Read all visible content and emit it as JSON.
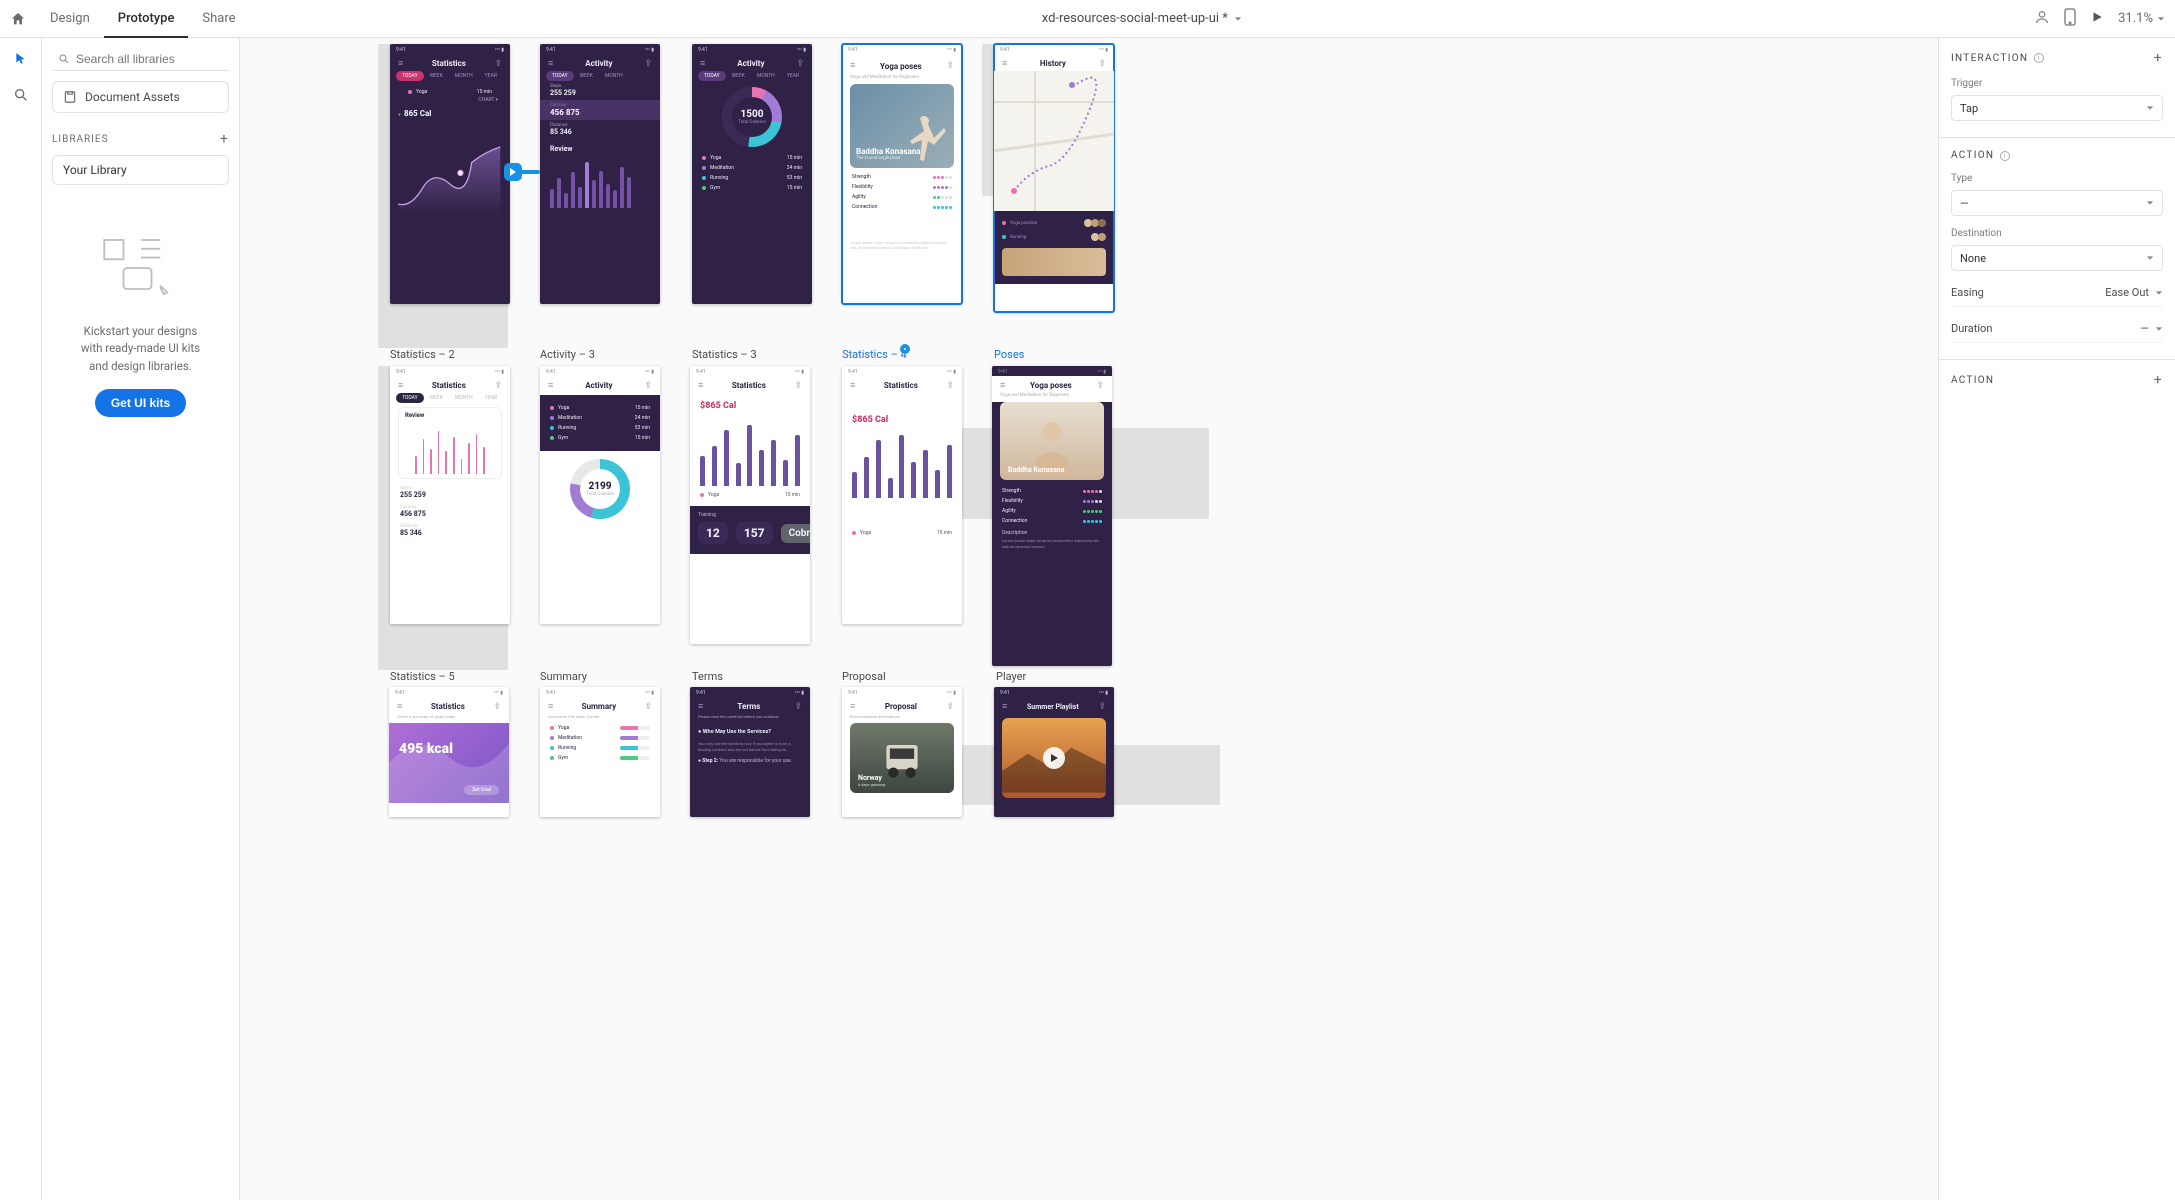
{
  "topbar": {
    "tabs": [
      "Design",
      "Prototype",
      "Share"
    ],
    "active_tab": "Prototype",
    "doc_title": "xd-resources-social-meet-up-ui *",
    "zoom": "31.1%"
  },
  "left_panel": {
    "search_placeholder": "Search all libraries",
    "doc_assets": "Document Assets",
    "libraries_header": "LIBRARIES",
    "your_library": "Your Library",
    "kickstart_lines": [
      "Kickstart your designs",
      "with ready-made UI kits",
      "and design libraries."
    ],
    "cta": "Get UI kits"
  },
  "right_panel": {
    "interaction_header": "INTERACTION",
    "trigger_label": "Trigger",
    "trigger_value": "Tap",
    "action_header": "ACTION",
    "type_label": "Type",
    "type_value": "—",
    "destination_label": "Destination",
    "destination_value": "None",
    "easing_label": "Easing",
    "easing_value": "Ease Out",
    "duration_label": "Duration",
    "duration_value": "—",
    "action_footer": "ACTION"
  },
  "canvas": {
    "status_time": "9:41",
    "row1": {
      "a": {
        "title": "Statistics",
        "tabs": [
          "TODAY",
          "WEEK",
          "MONTH",
          "YEAR"
        ],
        "active": "TODAY",
        "legend_name": "Yoga",
        "legend_time": "15 min",
        "cal": "865 Cal"
      },
      "b": {
        "title": "Activity",
        "steps_lbl": "Steps",
        "steps": "255 259",
        "cal_lbl": "Calories",
        "cal": "456 875",
        "dist_lbl": "Distance",
        "dist": "85 346",
        "review": "Review"
      },
      "c": {
        "title": "Activity",
        "tabs": [
          "TODAY",
          "WEEK",
          "MONTH",
          "YEAR"
        ],
        "active": "TODAY",
        "donut_center": "1500",
        "donut_sub": "Total Calories",
        "rows": [
          {
            "name": "Yoga",
            "color": "#e774b2",
            "val": "15 min"
          },
          {
            "name": "Meditation",
            "color": "#a07cd6",
            "val": "24 min"
          },
          {
            "name": "Running",
            "color": "#3bc4d6",
            "val": "53 min"
          },
          {
            "name": "Gym",
            "color": "#4ec97f",
            "val": "15 min"
          }
        ]
      },
      "d": {
        "title": "Yoga poses",
        "sub": "Yoga and Meditation for Beginners",
        "pose": "Baddha Konasana",
        "pose_sub": "The bound angle pose",
        "metrics": [
          {
            "name": "Strength",
            "color": "#e774b2",
            "n": 3
          },
          {
            "name": "Flexibility",
            "color": "#a07cd6",
            "n": 4
          },
          {
            "name": "Agility",
            "color": "#4ec97f",
            "n": 2
          },
          {
            "name": "Connection",
            "color": "#3bc4d6",
            "n": 5
          }
        ]
      },
      "e": {
        "title": "History"
      }
    },
    "labels_row1": [
      "Statistics – 2",
      "Activity – 3",
      "Statistics – 3",
      "Statistics  – 4",
      "Poses"
    ],
    "row2": {
      "a": {
        "title": "Statistics",
        "tabs": [
          "TODAY",
          "WEEK",
          "MONTH",
          "YEAR"
        ],
        "active": "TODAY",
        "review": "Review",
        "steps_lbl": "Steps",
        "steps": "255 259",
        "cal_lbl": "Calories",
        "cal": "456 875",
        "dist_lbl": "Distance",
        "dist": "85 346"
      },
      "b": {
        "title": "Activity",
        "rows": [
          {
            "name": "Yoga",
            "color": "#e774b2",
            "val": "15 min"
          },
          {
            "name": "Meditation",
            "color": "#a07cd6",
            "val": "24 min"
          },
          {
            "name": "Running",
            "color": "#3bc4d6",
            "val": "53 min"
          },
          {
            "name": "Gym",
            "color": "#4ec97f",
            "val": "15 min"
          }
        ],
        "donut_center": "2199",
        "donut_sub": "Total Calories"
      },
      "c": {
        "title": "Statistics",
        "cal": "$865 Cal",
        "legend": "Yoga",
        "training": "Training",
        "n1": "12",
        "n2": "157",
        "pose": "Cobra"
      },
      "d": {
        "title": "Statistics",
        "cal": "$865 Cal",
        "legend": "Yoga",
        "legend_time": "15 min"
      },
      "e": {
        "title": "Yoga poses",
        "sub": "Yoga and Meditation for Beginners",
        "pose": "Baddha Konasana",
        "metrics": [
          {
            "name": "Strength",
            "color": "#e774b2",
            "n": 4
          },
          {
            "name": "Flexibility",
            "color": "#a07cd6",
            "n": 3
          },
          {
            "name": "Agility",
            "color": "#4ec97f",
            "n": 5
          },
          {
            "name": "Connection",
            "color": "#3bc4d6",
            "n": 5
          }
        ],
        "desc_label": "Description"
      }
    },
    "labels_row2": [
      "Statistics – 5",
      "Summary",
      "Terms",
      "Proposal",
      "Player"
    ],
    "row3": {
      "a": {
        "title": "Statistics",
        "kcal": "495 kcal",
        "cta": "Set Goal"
      },
      "b": {
        "title": "Summary",
        "sub": "Good work this week, Zarela!",
        "rows": [
          {
            "name": "Yoga",
            "color": "#e774b2"
          },
          {
            "name": "Meditation",
            "color": "#a07cd6"
          },
          {
            "name": "Running",
            "color": "#3bc4d6"
          },
          {
            "name": "Gym",
            "color": "#4ec97f"
          }
        ]
      },
      "c": {
        "title": "Terms",
        "sub": "Please read this carefully before you continue",
        "q": "Who May Use the Services?",
        "step": "Step 2:"
      },
      "d": {
        "title": "Proposal",
        "dest": "Norway"
      },
      "e": {
        "title": "Summer Playlist"
      }
    }
  }
}
